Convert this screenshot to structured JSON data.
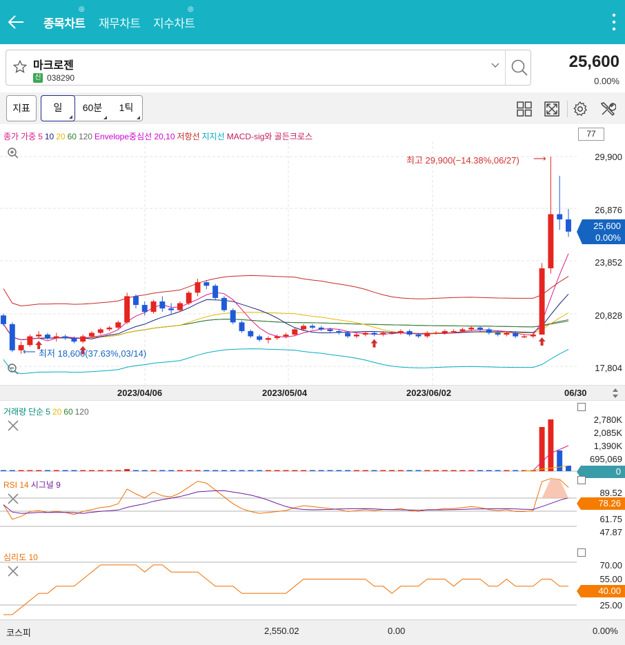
{
  "header": {
    "tabs": [
      {
        "label": "종목차트",
        "active": true
      },
      {
        "label": "재무차트",
        "active": false
      },
      {
        "label": "지수차트",
        "active": false
      }
    ]
  },
  "stock": {
    "name": "마크로젠",
    "badge": "신",
    "code": "038290",
    "price": "25,600",
    "change": "0.00%"
  },
  "toolbar": {
    "indicator_label": "지표",
    "periods": [
      "일",
      "60분",
      "1틱"
    ],
    "selected_period": "일",
    "count": "77"
  },
  "legend": [
    {
      "text": "종가",
      "color": "#d81b8a"
    },
    {
      "text": "가중",
      "color": "#d81b8a"
    },
    {
      "text": "5",
      "color": "#d81b8a"
    },
    {
      "text": "10",
      "color": "#1a237e"
    },
    {
      "text": "20",
      "color": "#e6b800"
    },
    {
      "text": "60",
      "color": "#2e7d32"
    },
    {
      "text": "120",
      "color": "#666666"
    },
    {
      "text": "Envelope중심선 20,10",
      "color": "#cc00cc"
    },
    {
      "text": "저항선",
      "color": "#c62828"
    },
    {
      "text": "지지선",
      "color": "#00acc1"
    },
    {
      "text": "MACD-sig와 골든크로스",
      "color": "#c2185b"
    }
  ],
  "price_axis": [
    "29,900",
    "26,876",
    "23,852",
    "20,828",
    "17,804"
  ],
  "price_tag": {
    "value": "25,600",
    "change": "0.00%",
    "color": "#1565c0"
  },
  "annotations": {
    "high": "최고 29,900(−14.38%,06/27)",
    "low": "최저 18,600(37.63%,03/14)"
  },
  "dates": [
    "2023/04/06",
    "2023/05/04",
    "2023/06/02",
    "06/30"
  ],
  "volume_panel": {
    "title_parts": [
      {
        "text": "거래량",
        "color": "#00897b"
      },
      {
        "text": "단순",
        "color": "#00897b"
      },
      {
        "text": "5",
        "color": "#00897b"
      },
      {
        "text": "20",
        "color": "#e6b800"
      },
      {
        "text": "60",
        "color": "#2e7d32"
      },
      {
        "text": "120",
        "color": "#666666"
      }
    ],
    "axis": [
      "2,780K",
      "2,085K",
      "1,390K",
      "695,069"
    ],
    "tag": "0",
    "tag_color": "#3a9ca8"
  },
  "rsi_panel": {
    "title_parts": [
      {
        "text": "RSI 14",
        "color": "#ef6c00"
      },
      {
        "text": "시그널 9",
        "color": "#6a1b9a"
      }
    ],
    "axis": [
      "89.52",
      "61.75",
      "47.87"
    ],
    "tag": "78.26",
    "tag_color": "#f57c00"
  },
  "psy_panel": {
    "title_parts": [
      {
        "text": "심리도 10",
        "color": "#ef6c00"
      }
    ],
    "axis": [
      "70.00",
      "55.00",
      "25.00"
    ],
    "tag": "40.00",
    "tag_color": "#f57c00"
  },
  "bottom_bar": {
    "index_name": "코스피",
    "index_value": "2,550.02",
    "index_change": "0.00",
    "index_rate": "0.00%"
  },
  "colors": {
    "accent": "#17b3c4",
    "up": "#e5251f",
    "down": "#1f5bd8"
  },
  "chart_data": {
    "type": "candlestick",
    "ylim": [
      17804,
      29900
    ],
    "candles": [
      [
        20800,
        20900,
        20200,
        20300
      ],
      [
        20300,
        20400,
        18700,
        18800
      ],
      [
        18800,
        19300,
        18600,
        19100
      ],
      [
        19100,
        19700,
        19000,
        19600
      ],
      [
        19600,
        19900,
        19500,
        19700
      ],
      [
        19700,
        19800,
        19400,
        19500
      ],
      [
        19500,
        19800,
        19300,
        19600
      ],
      [
        19600,
        19700,
        19400,
        19500
      ],
      [
        19500,
        19600,
        19200,
        19300
      ],
      [
        19300,
        19700,
        19200,
        19600
      ],
      [
        19600,
        19900,
        19500,
        19800
      ],
      [
        19800,
        20100,
        19700,
        20000
      ],
      [
        20000,
        20200,
        19900,
        20100
      ],
      [
        20100,
        20500,
        20000,
        20400
      ],
      [
        20400,
        22100,
        20300,
        21900
      ],
      [
        21900,
        22000,
        21200,
        21400
      ],
      [
        21400,
        21600,
        20800,
        21000
      ],
      [
        21000,
        21700,
        20900,
        21600
      ],
      [
        21600,
        21900,
        21000,
        21200
      ],
      [
        21200,
        21500,
        20900,
        21100
      ],
      [
        21100,
        21600,
        21000,
        21500
      ],
      [
        21500,
        22200,
        21400,
        22100
      ],
      [
        22100,
        22900,
        21900,
        22700
      ],
      [
        22700,
        22800,
        22300,
        22500
      ],
      [
        22500,
        22600,
        21700,
        21800
      ],
      [
        21800,
        21900,
        21000,
        21100
      ],
      [
        21100,
        21200,
        20300,
        20400
      ],
      [
        20400,
        20500,
        19800,
        19900
      ],
      [
        19900,
        20000,
        19500,
        19600
      ],
      [
        19600,
        19700,
        19300,
        19400
      ],
      [
        19400,
        19600,
        19200,
        19500
      ],
      [
        19500,
        19700,
        19400,
        19600
      ],
      [
        19600,
        19800,
        19500,
        19700
      ],
      [
        19700,
        20100,
        19600,
        20000
      ],
      [
        20000,
        20300,
        19900,
        20200
      ],
      [
        20200,
        20300,
        20000,
        20100
      ],
      [
        20100,
        20200,
        19900,
        20000
      ],
      [
        20000,
        20100,
        19800,
        19900
      ],
      [
        19900,
        20000,
        19700,
        19800
      ],
      [
        19800,
        19900,
        19500,
        19600
      ],
      [
        19600,
        19800,
        19500,
        19700
      ],
      [
        19700,
        19900,
        19600,
        19800
      ],
      [
        19800,
        19900,
        19600,
        19700
      ],
      [
        19700,
        19900,
        19600,
        19800
      ],
      [
        19800,
        19900,
        19700,
        19800
      ],
      [
        19800,
        20000,
        19700,
        19900
      ],
      [
        19900,
        20000,
        19600,
        19700
      ],
      [
        19700,
        19800,
        19500,
        19600
      ],
      [
        19600,
        19900,
        19500,
        19800
      ],
      [
        19800,
        19900,
        19700,
        19800
      ],
      [
        19800,
        20000,
        19700,
        19900
      ],
      [
        19900,
        20000,
        19800,
        19900
      ],
      [
        19900,
        20100,
        19800,
        20000
      ],
      [
        20000,
        20200,
        19900,
        20100
      ],
      [
        20100,
        20200,
        19900,
        20000
      ],
      [
        20000,
        20100,
        19700,
        19800
      ],
      [
        19800,
        19900,
        19600,
        19700
      ],
      [
        19700,
        19900,
        19600,
        19800
      ],
      [
        19800,
        19900,
        19500,
        19600
      ],
      [
        19600,
        19700,
        19500,
        19600
      ],
      [
        19600,
        19800,
        19500,
        19700
      ],
      [
        19700,
        23800,
        19700,
        23500
      ],
      [
        23500,
        29900,
        23200,
        26600
      ],
      [
        26600,
        28800,
        25700,
        26300
      ],
      [
        26300,
        26900,
        25300,
        25600
      ]
    ]
  }
}
